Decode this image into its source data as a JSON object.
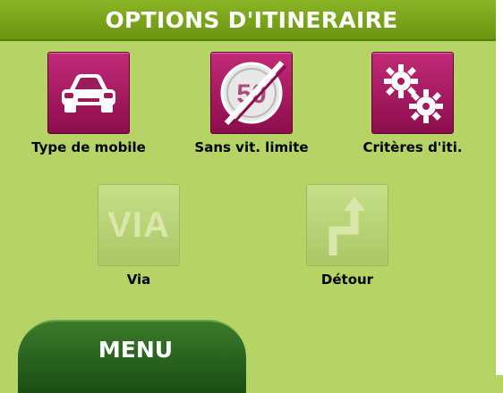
{
  "header": {
    "title": "OPTIONS D'ITINERAIRE"
  },
  "options": {
    "vehicle": {
      "label": "Type de mobile",
      "icon": "car-icon"
    },
    "no_speed_limit": {
      "label": "Sans vit. limite",
      "icon": "speed-limit-50-crossed-icon",
      "sign_text": "50"
    },
    "route_criteria": {
      "label": "Critères d'iti.",
      "icon": "gears-icon"
    },
    "via": {
      "label": "Via",
      "icon": "via-icon",
      "icon_text": "VIA",
      "state": "disabled"
    },
    "detour": {
      "label": "Détour",
      "icon": "detour-arrow-icon",
      "state": "disabled"
    }
  },
  "footer": {
    "menu_label": "MENU"
  },
  "colors": {
    "background": "#b5d465",
    "title_bar": "#7aa51a",
    "active_icon": "#a8175e",
    "disabled_icon": "#bcd67a",
    "menu_button": "#2a6420"
  }
}
